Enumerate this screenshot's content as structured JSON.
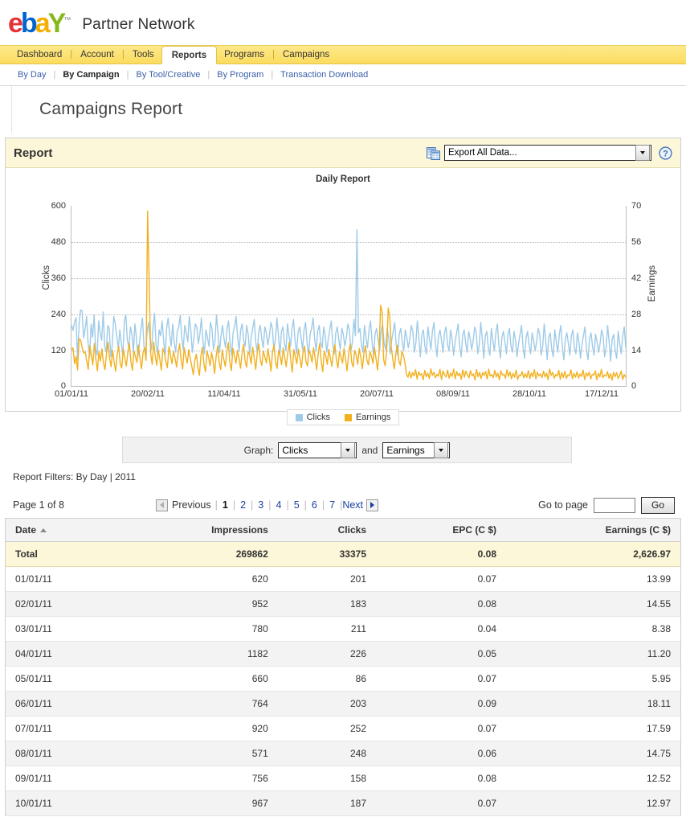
{
  "brand": {
    "logo_letters": [
      "e",
      "b",
      "a",
      "Y"
    ],
    "name": "Partner Network",
    "trademark": "™"
  },
  "nav": {
    "tabs": [
      {
        "label": "Dashboard",
        "active": false
      },
      {
        "label": "Account",
        "active": false
      },
      {
        "label": "Tools",
        "active": false
      },
      {
        "label": "Reports",
        "active": true
      },
      {
        "label": "Programs",
        "active": false
      },
      {
        "label": "Campaigns",
        "active": false
      }
    ],
    "separator": "|"
  },
  "subnav": {
    "items": [
      {
        "label": "By Day",
        "current": false
      },
      {
        "label": "By Campaign",
        "current": true
      },
      {
        "label": "By Tool/Creative",
        "current": false
      },
      {
        "label": "By Program",
        "current": false
      },
      {
        "label": "Transaction Download",
        "current": false
      }
    ],
    "separator": "|"
  },
  "page_title": "Campaigns Report",
  "panel": {
    "title": "Report",
    "export_value": "Export All Data...",
    "export_icon": "spreadsheet-export-icon",
    "help_icon": "help-question-icon"
  },
  "graph_selector": {
    "prefix": "Graph:",
    "primary_value": "Clicks",
    "conjunction": "and",
    "secondary_value": "Earnings"
  },
  "filters_text": "Report Filters: By Day | 2011",
  "pagination": {
    "page_label": "Page 1 of 8",
    "previous_label": "Previous",
    "next_label": "Next",
    "pages": [
      "1",
      "2",
      "3",
      "4",
      "5",
      "6",
      "7"
    ],
    "current_page": "1",
    "goto_label": "Go to page",
    "goto_value": "",
    "go_button": "Go",
    "separator": "|"
  },
  "table": {
    "columns": [
      {
        "label": "Date",
        "align": "l",
        "sorted": true
      },
      {
        "label": "Impressions",
        "align": "r",
        "sorted": false
      },
      {
        "label": "Clicks",
        "align": "r",
        "sorted": false
      },
      {
        "label": "EPC (C $)",
        "align": "r",
        "sorted": false
      },
      {
        "label": "Earnings (C $)",
        "align": "r",
        "sorted": false
      }
    ],
    "total_row": {
      "label": "Total",
      "impressions": "269862",
      "clicks": "33375",
      "epc": "0.08",
      "earnings": "2,626.97"
    },
    "rows": [
      {
        "date": "01/01/11",
        "impressions": "620",
        "clicks": "201",
        "epc": "0.07",
        "earnings": "13.99"
      },
      {
        "date": "02/01/11",
        "impressions": "952",
        "clicks": "183",
        "epc": "0.08",
        "earnings": "14.55"
      },
      {
        "date": "03/01/11",
        "impressions": "780",
        "clicks": "211",
        "epc": "0.04",
        "earnings": "8.38"
      },
      {
        "date": "04/01/11",
        "impressions": "1182",
        "clicks": "226",
        "epc": "0.05",
        "earnings": "11.20"
      },
      {
        "date": "05/01/11",
        "impressions": "660",
        "clicks": "86",
        "epc": "0.07",
        "earnings": "5.95"
      },
      {
        "date": "06/01/11",
        "impressions": "764",
        "clicks": "203",
        "epc": "0.09",
        "earnings": "18.11"
      },
      {
        "date": "07/01/11",
        "impressions": "920",
        "clicks": "252",
        "epc": "0.07",
        "earnings": "17.59"
      },
      {
        "date": "08/01/11",
        "impressions": "571",
        "clicks": "248",
        "epc": "0.06",
        "earnings": "14.75"
      },
      {
        "date": "09/01/11",
        "impressions": "756",
        "clicks": "158",
        "epc": "0.08",
        "earnings": "12.52"
      },
      {
        "date": "10/01/11",
        "impressions": "967",
        "clicks": "187",
        "epc": "0.07",
        "earnings": "12.97"
      }
    ]
  },
  "colors": {
    "clicks": "#9ecbe8",
    "earnings": "#f2b01e",
    "tab_bar": "#fcdc5f",
    "panel_head": "#fcf7d8",
    "link": "#1a3fa0"
  },
  "chart_data": {
    "type": "line",
    "title": "Daily Report",
    "xlabel": "",
    "ylabel": "Clicks",
    "y2label": "Earnings",
    "ylim": [
      0,
      600
    ],
    "y2lim": [
      0,
      70
    ],
    "yticks": [
      0,
      120,
      240,
      360,
      480,
      600
    ],
    "y2ticks": [
      0,
      14,
      28,
      42,
      56,
      70
    ],
    "xticks": [
      "01/01/11",
      "20/02/11",
      "11/04/11",
      "31/05/11",
      "20/07/11",
      "08/09/11",
      "28/10/11",
      "17/12/11"
    ],
    "xtick_positions": [
      0,
      50,
      100,
      150,
      200,
      250,
      300,
      350
    ],
    "x_range": [
      0,
      364
    ],
    "grid": true,
    "legend_position": "bottom-center",
    "series": [
      {
        "name": "Clicks",
        "axis": "left",
        "color": "#9ecbe8",
        "values": [
          201,
          183,
          211,
          226,
          86,
          203,
          252,
          248,
          158,
          187,
          230,
          140,
          95,
          205,
          160,
          235,
          120,
          100,
          215,
          175,
          150,
          245,
          130,
          110,
          200,
          190,
          95,
          135,
          230,
          205,
          165,
          120,
          185,
          140,
          100,
          215,
          235,
          150,
          125,
          195,
          170,
          110,
          205,
          160,
          95,
          140,
          190,
          225,
          130,
          100,
          175,
          210,
          155,
          120,
          195,
          240,
          135,
          105,
          185,
          165,
          215,
          150,
          100,
          190,
          225,
          170,
          130,
          205,
          145,
          110,
          180,
          195,
          235,
          160,
          120,
          200,
          175,
          145,
          230,
          185,
          110,
          155,
          205,
          195,
          140,
          170,
          225,
          150,
          105,
          185,
          160,
          130,
          210,
          190,
          120,
          145,
          235,
          175,
          110,
          165,
          200,
          155,
          125,
          190,
          215,
          140,
          100,
          175,
          195,
          230,
          160,
          115,
          185,
          205,
          150,
          130,
          200,
          170,
          105,
          160,
          190,
          220,
          145,
          110,
          180,
          200,
          155,
          125,
          195,
          175,
          135,
          165,
          210,
          190,
          120,
          150,
          225,
          170,
          100,
          180,
          195,
          140,
          115,
          205,
          165,
          130,
          190,
          220,
          150,
          105,
          175,
          195,
          160,
          120,
          185,
          210,
          140,
          100,
          170,
          190,
          225,
          155,
          115,
          180,
          200,
          145,
          125,
          195,
          165,
          110,
          155,
          185,
          215,
          140,
          105,
          175,
          195,
          150,
          120,
          190,
          170,
          130,
          160,
          205,
          185,
          115,
          145,
          220,
          165,
          520,
          175,
          190,
          135,
          110,
          200,
          160,
          125,
          185,
          215,
          145,
          100,
          170,
          190,
          155,
          115,
          180,
          205,
          140,
          120,
          190,
          160,
          105,
          150,
          180,
          210,
          135,
          100,
          170,
          190,
          145,
          115,
          185,
          160,
          125,
          155,
          200,
          180,
          110,
          140,
          215,
          160,
          95,
          170,
          185,
          130,
          105,
          195,
          155,
          120,
          180,
          210,
          140,
          95,
          165,
          185,
          150,
          110,
          175,
          195,
          135,
          115,
          185,
          155,
          100,
          145,
          175,
          205,
          130,
          95,
          165,
          185,
          140,
          110,
          180,
          155,
          120,
          150,
          195,
          175,
          105,
          135,
          210,
          155,
          90,
          165,
          180,
          125,
          100,
          190,
          150,
          115,
          175,
          205,
          135,
          90,
          160,
          180,
          145,
          105,
          170,
          190,
          130,
          110,
          180,
          150,
          95,
          140,
          170,
          200,
          125,
          90,
          160,
          180,
          135,
          105,
          175,
          150,
          115,
          145,
          190,
          170,
          100,
          130,
          205,
          150,
          85,
          160,
          175,
          120,
          95,
          185,
          145,
          110,
          170,
          200,
          130,
          85,
          155,
          175,
          140,
          100,
          165,
          185,
          125,
          105,
          175,
          145,
          90,
          135,
          165,
          195,
          120,
          85,
          155,
          175,
          130,
          100,
          170,
          145,
          110,
          140,
          185,
          165,
          95,
          125,
          200,
          145,
          80,
          155,
          170,
          115,
          90,
          180,
          140,
          105,
          165,
          195,
          125
        ]
      },
      {
        "name": "Earnings",
        "axis": "right",
        "color": "#f2b01e",
        "values": [
          13.99,
          14.55,
          8.38,
          11.2,
          5.95,
          18.11,
          17.59,
          14.75,
          12.52,
          12.97,
          9.5,
          6.2,
          15.4,
          11.8,
          7.9,
          16.3,
          10.2,
          5.6,
          13.1,
          9.4,
          14.2,
          8.7,
          6.1,
          12.3,
          16.8,
          10.5,
          7.2,
          13.6,
          9.1,
          5.4,
          11.9,
          15.2,
          8.3,
          6.7,
          14.1,
          10.8,
          7.5,
          12.6,
          16.4,
          9.3,
          5.8,
          13.4,
          11.1,
          8.9,
          15.6,
          10.3,
          6.4,
          12.8,
          14.7,
          9.6,
          68.0,
          41.5,
          12.2,
          8.1,
          16.9,
          11.4,
          7.8,
          13.7,
          10.1,
          5.9,
          14.3,
          12.5,
          9.2,
          6.8,
          15.1,
          11.7,
          8.4,
          13.2,
          10.6,
          7.1,
          12.4,
          16.2,
          9.8,
          6.3,
          14.6,
          11.3,
          8.6,
          13.9,
          10.4,
          7.4,
          4.1,
          9.7,
          12.1,
          6.9,
          3.8,
          11.5,
          14.8,
          8.2,
          5.2,
          13.3,
          10.9,
          7.6,
          12.7,
          9.4,
          4.6,
          11.2,
          15.4,
          8.8,
          6.1,
          13.8,
          10.2,
          7.3,
          12.9,
          16.6,
          9.1,
          5.7,
          14.4,
          11.6,
          8.5,
          13.5,
          10.7,
          6.6,
          12.2,
          15.9,
          9.5,
          7.0,
          13.1,
          11.8,
          8.3,
          14.9,
          10.5,
          6.2,
          12.6,
          16.1,
          9.9,
          7.7,
          13.4,
          11.0,
          8.7,
          14.2,
          10.1,
          5.5,
          12.8,
          15.7,
          9.3,
          6.5,
          13.6,
          11.4,
          8.0,
          14.5,
          10.9,
          7.2,
          12.3,
          16.7,
          9.6,
          5.1,
          13.9,
          11.2,
          8.4,
          14.1,
          10.3,
          6.8,
          12.5,
          15.3,
          9.2,
          7.5,
          13.7,
          11.9,
          8.9,
          14.6,
          10.7,
          6.0,
          12.1,
          16.3,
          9.4,
          5.3,
          13.2,
          11.5,
          8.1,
          14.0,
          10.6,
          7.4,
          12.9,
          15.8,
          9.7,
          6.7,
          13.3,
          11.1,
          8.6,
          14.4,
          10.0,
          5.6,
          12.4,
          16.0,
          9.0,
          7.1,
          13.5,
          11.7,
          8.2,
          14.3,
          10.8,
          6.4,
          12.0,
          15.5,
          9.8,
          7.9,
          13.0,
          11.3,
          8.5,
          14.7,
          10.4,
          5.9,
          12.7,
          31.2,
          28.5,
          9.9,
          7.6,
          13.8,
          30.1,
          26.8,
          14.8,
          10.2,
          6.3,
          12.2,
          15.6,
          9.5,
          7.8,
          13.4,
          11.6,
          8.8,
          4.2,
          3.1,
          5.4,
          2.8,
          4.9,
          3.6,
          6.1,
          2.4,
          5.2,
          3.9,
          4.5,
          2.1,
          5.8,
          3.3,
          4.7,
          2.6,
          6.4,
          3.8,
          5.1,
          2.9,
          4.3,
          3.5,
          6.2,
          2.2,
          5.6,
          4.0,
          3.2,
          5.9,
          2.7,
          4.8,
          3.4,
          6.3,
          2.5,
          5.3,
          3.7,
          4.6,
          2.3,
          6.0,
          3.1,
          5.5,
          4.1,
          2.8,
          5.7,
          3.6,
          4.4,
          2.0,
          6.1,
          3.3,
          5.0,
          2.6,
          4.9,
          3.8,
          5.4,
          2.4,
          6.2,
          3.5,
          4.2,
          2.9,
          5.8,
          3.2,
          4.7,
          2.1,
          5.6,
          3.9,
          4.3,
          2.7,
          6.0,
          3.4,
          5.2,
          2.5,
          4.6,
          3.1,
          5.9,
          2.2,
          4.0,
          3.7,
          5.3,
          2.8,
          4.5,
          3.0,
          5.7,
          2.6,
          4.8,
          3.3,
          6.1,
          2.4,
          5.1,
          3.6,
          4.4,
          2.9,
          5.5,
          3.2,
          4.7,
          2.1,
          6.3,
          3.8,
          5.0,
          2.7,
          4.2,
          3.5,
          5.8,
          2.3,
          4.9,
          3.0,
          5.4,
          2.6,
          4.1,
          3.7,
          6.0,
          2.5,
          4.6,
          3.1,
          5.2,
          2.8,
          4.4,
          3.4,
          5.9,
          2.2,
          4.8,
          3.6,
          5.1,
          2.4,
          4.3,
          3.9,
          5.6,
          2.1,
          4.7,
          3.2,
          6.2,
          2.9,
          4.0,
          3.5,
          5.3,
          2.7,
          4.5,
          1.9,
          5.0,
          3.3,
          4.9,
          2.6,
          3.8,
          5.5,
          2.2,
          4.2,
          3.0
        ]
      }
    ]
  }
}
